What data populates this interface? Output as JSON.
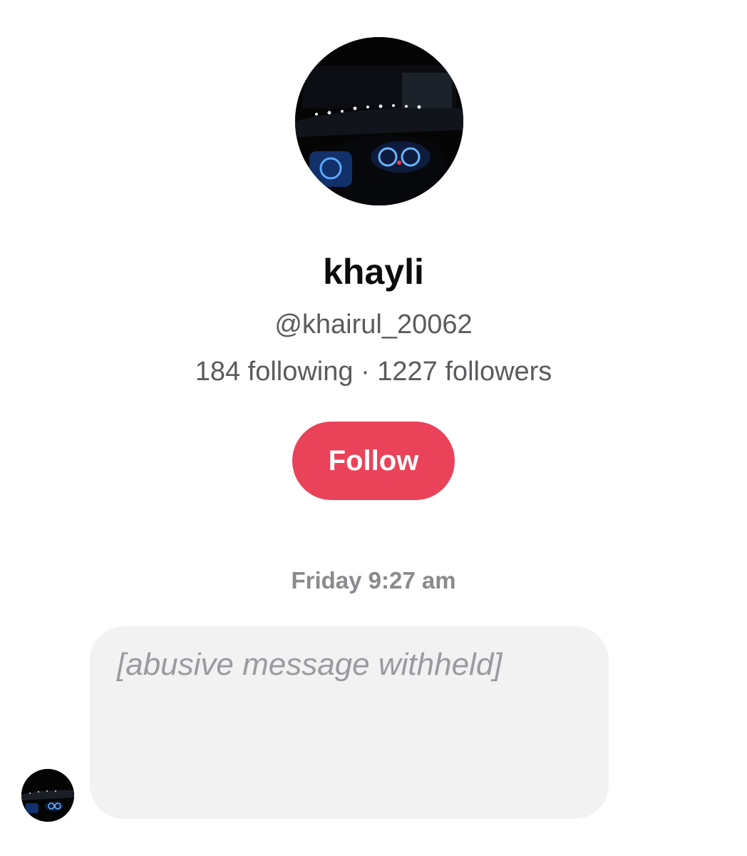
{
  "profile": {
    "display_name": "khayli",
    "username": "@khairul_20062",
    "stats": "184 following · 1227 followers",
    "follow_label": "Follow",
    "accent_color": "#ea4259",
    "avatar_icon": "night-car-dashboard-photo"
  },
  "chat": {
    "timestamp": "Friday 9:27 am",
    "message_text": "[abusive message withheld]"
  }
}
